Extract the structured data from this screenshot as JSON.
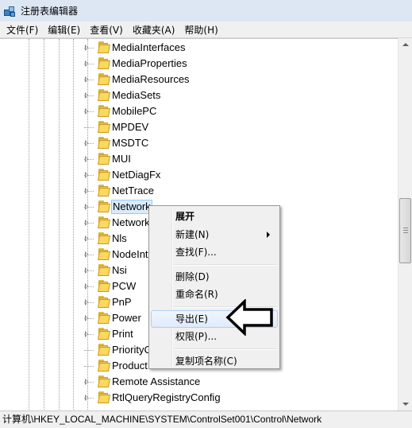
{
  "window": {
    "title": "注册表编辑器"
  },
  "menubar": {
    "items": [
      "文件(F)",
      "编辑(E)",
      "查看(V)",
      "收藏夹(A)",
      "帮助(H)"
    ]
  },
  "tree": {
    "nodes": [
      {
        "label": "MediaInterfaces",
        "expandable": true
      },
      {
        "label": "MediaProperties",
        "expandable": true
      },
      {
        "label": "MediaResources",
        "expandable": true
      },
      {
        "label": "MediaSets",
        "expandable": true
      },
      {
        "label": "MobilePC",
        "expandable": true
      },
      {
        "label": "MPDEV",
        "expandable": false
      },
      {
        "label": "MSDTC",
        "expandable": true
      },
      {
        "label": "MUI",
        "expandable": true
      },
      {
        "label": "NetDiagFx",
        "expandable": true
      },
      {
        "label": "NetTrace",
        "expandable": true
      },
      {
        "label": "Network",
        "expandable": true,
        "selected": true
      },
      {
        "label": "Network",
        "expandable": true
      },
      {
        "label": "Nls",
        "expandable": true
      },
      {
        "label": "NodeInt",
        "expandable": true
      },
      {
        "label": "Nsi",
        "expandable": true
      },
      {
        "label": "PCW",
        "expandable": true
      },
      {
        "label": "PnP",
        "expandable": true
      },
      {
        "label": "Power",
        "expandable": true
      },
      {
        "label": "Print",
        "expandable": true
      },
      {
        "label": "PriorityC",
        "expandable": false
      },
      {
        "label": "Product",
        "expandable": false
      },
      {
        "label": "Remote Assistance",
        "expandable": true
      },
      {
        "label": "RtlQueryRegistryConfig",
        "expandable": true
      }
    ]
  },
  "context_menu": {
    "items": [
      {
        "label": "展开",
        "bold": true
      },
      {
        "label": "新建(N)",
        "submenu": true
      },
      {
        "label": "查找(F)..."
      },
      {
        "separator": true
      },
      {
        "label": "删除(D)"
      },
      {
        "label": "重命名(R)"
      },
      {
        "separator": true
      },
      {
        "label": "导出(E)",
        "highlighted": true
      },
      {
        "label": "权限(P)..."
      },
      {
        "separator": true
      },
      {
        "label": "复制项名称(C)"
      }
    ]
  },
  "statusbar": {
    "path": "计算机\\HKEY_LOCAL_MACHINE\\SYSTEM\\ControlSet001\\Control\\Network"
  },
  "icons": {
    "app": "registry-editor-icon",
    "folder": "folder-icon",
    "expander": "expand-triangle-icon",
    "callout": "arrow-pointer-icon"
  },
  "colors": {
    "selection_bg": "#d9ebfb",
    "menu_highlight_border": "#aecff7",
    "folder": "#fbd85e"
  }
}
